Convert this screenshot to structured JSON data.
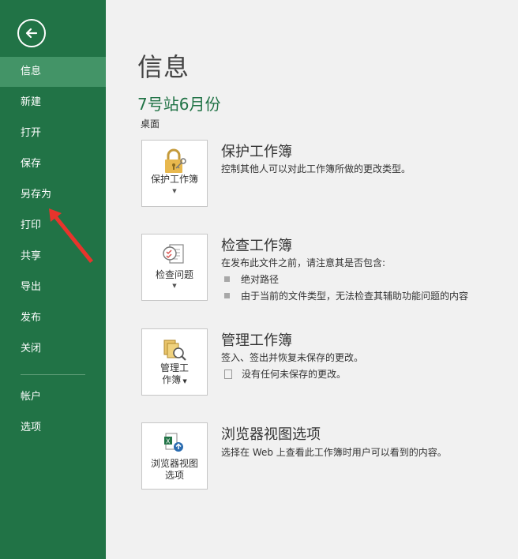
{
  "sidebar": {
    "back_icon": "arrow-left-circle-icon",
    "items": [
      {
        "label": "信息",
        "active": true
      },
      {
        "label": "新建"
      },
      {
        "label": "打开"
      },
      {
        "label": "保存"
      },
      {
        "label": "另存为"
      },
      {
        "label": "打印"
      },
      {
        "label": "共享"
      },
      {
        "label": "导出"
      },
      {
        "label": "发布"
      },
      {
        "label": "关闭"
      },
      {
        "label": "帐户"
      },
      {
        "label": "选项"
      }
    ]
  },
  "main": {
    "title": "信息",
    "document_name": "7号站6月份",
    "location": "桌面",
    "sections": [
      {
        "button_label": "保护工作簿",
        "icon": "lock-key-icon",
        "title": "保护工作簿",
        "description": "控制其他人可以对此工作簿所做的更改类型。"
      },
      {
        "button_label": "检查问题",
        "icon": "checklist-icon",
        "title": "检查工作簿",
        "description": "在发布此文件之前，请注意其是否包含:",
        "bullets": [
          "绝对路径",
          "由于当前的文件类型，无法检查其辅助功能问题的内容"
        ]
      },
      {
        "button_label_line1": "管理工",
        "button_label_line2": "作簿",
        "icon": "manage-workbook-icon",
        "title": "管理工作簿",
        "description": "签入、签出并恢复未保存的更改。",
        "note": "没有任何未保存的更改。"
      },
      {
        "button_label_line1": "浏览器视图",
        "button_label_line2": "选项",
        "icon": "browser-view-icon",
        "title": "浏览器视图选项",
        "description": "选择在 Web 上查看此工作簿时用户可以看到的内容。"
      }
    ]
  },
  "colors": {
    "sidebar_bg": "#217346",
    "sidebar_active": "#439467",
    "doc_name": "#217346",
    "annotation_arrow": "#e8342c"
  }
}
